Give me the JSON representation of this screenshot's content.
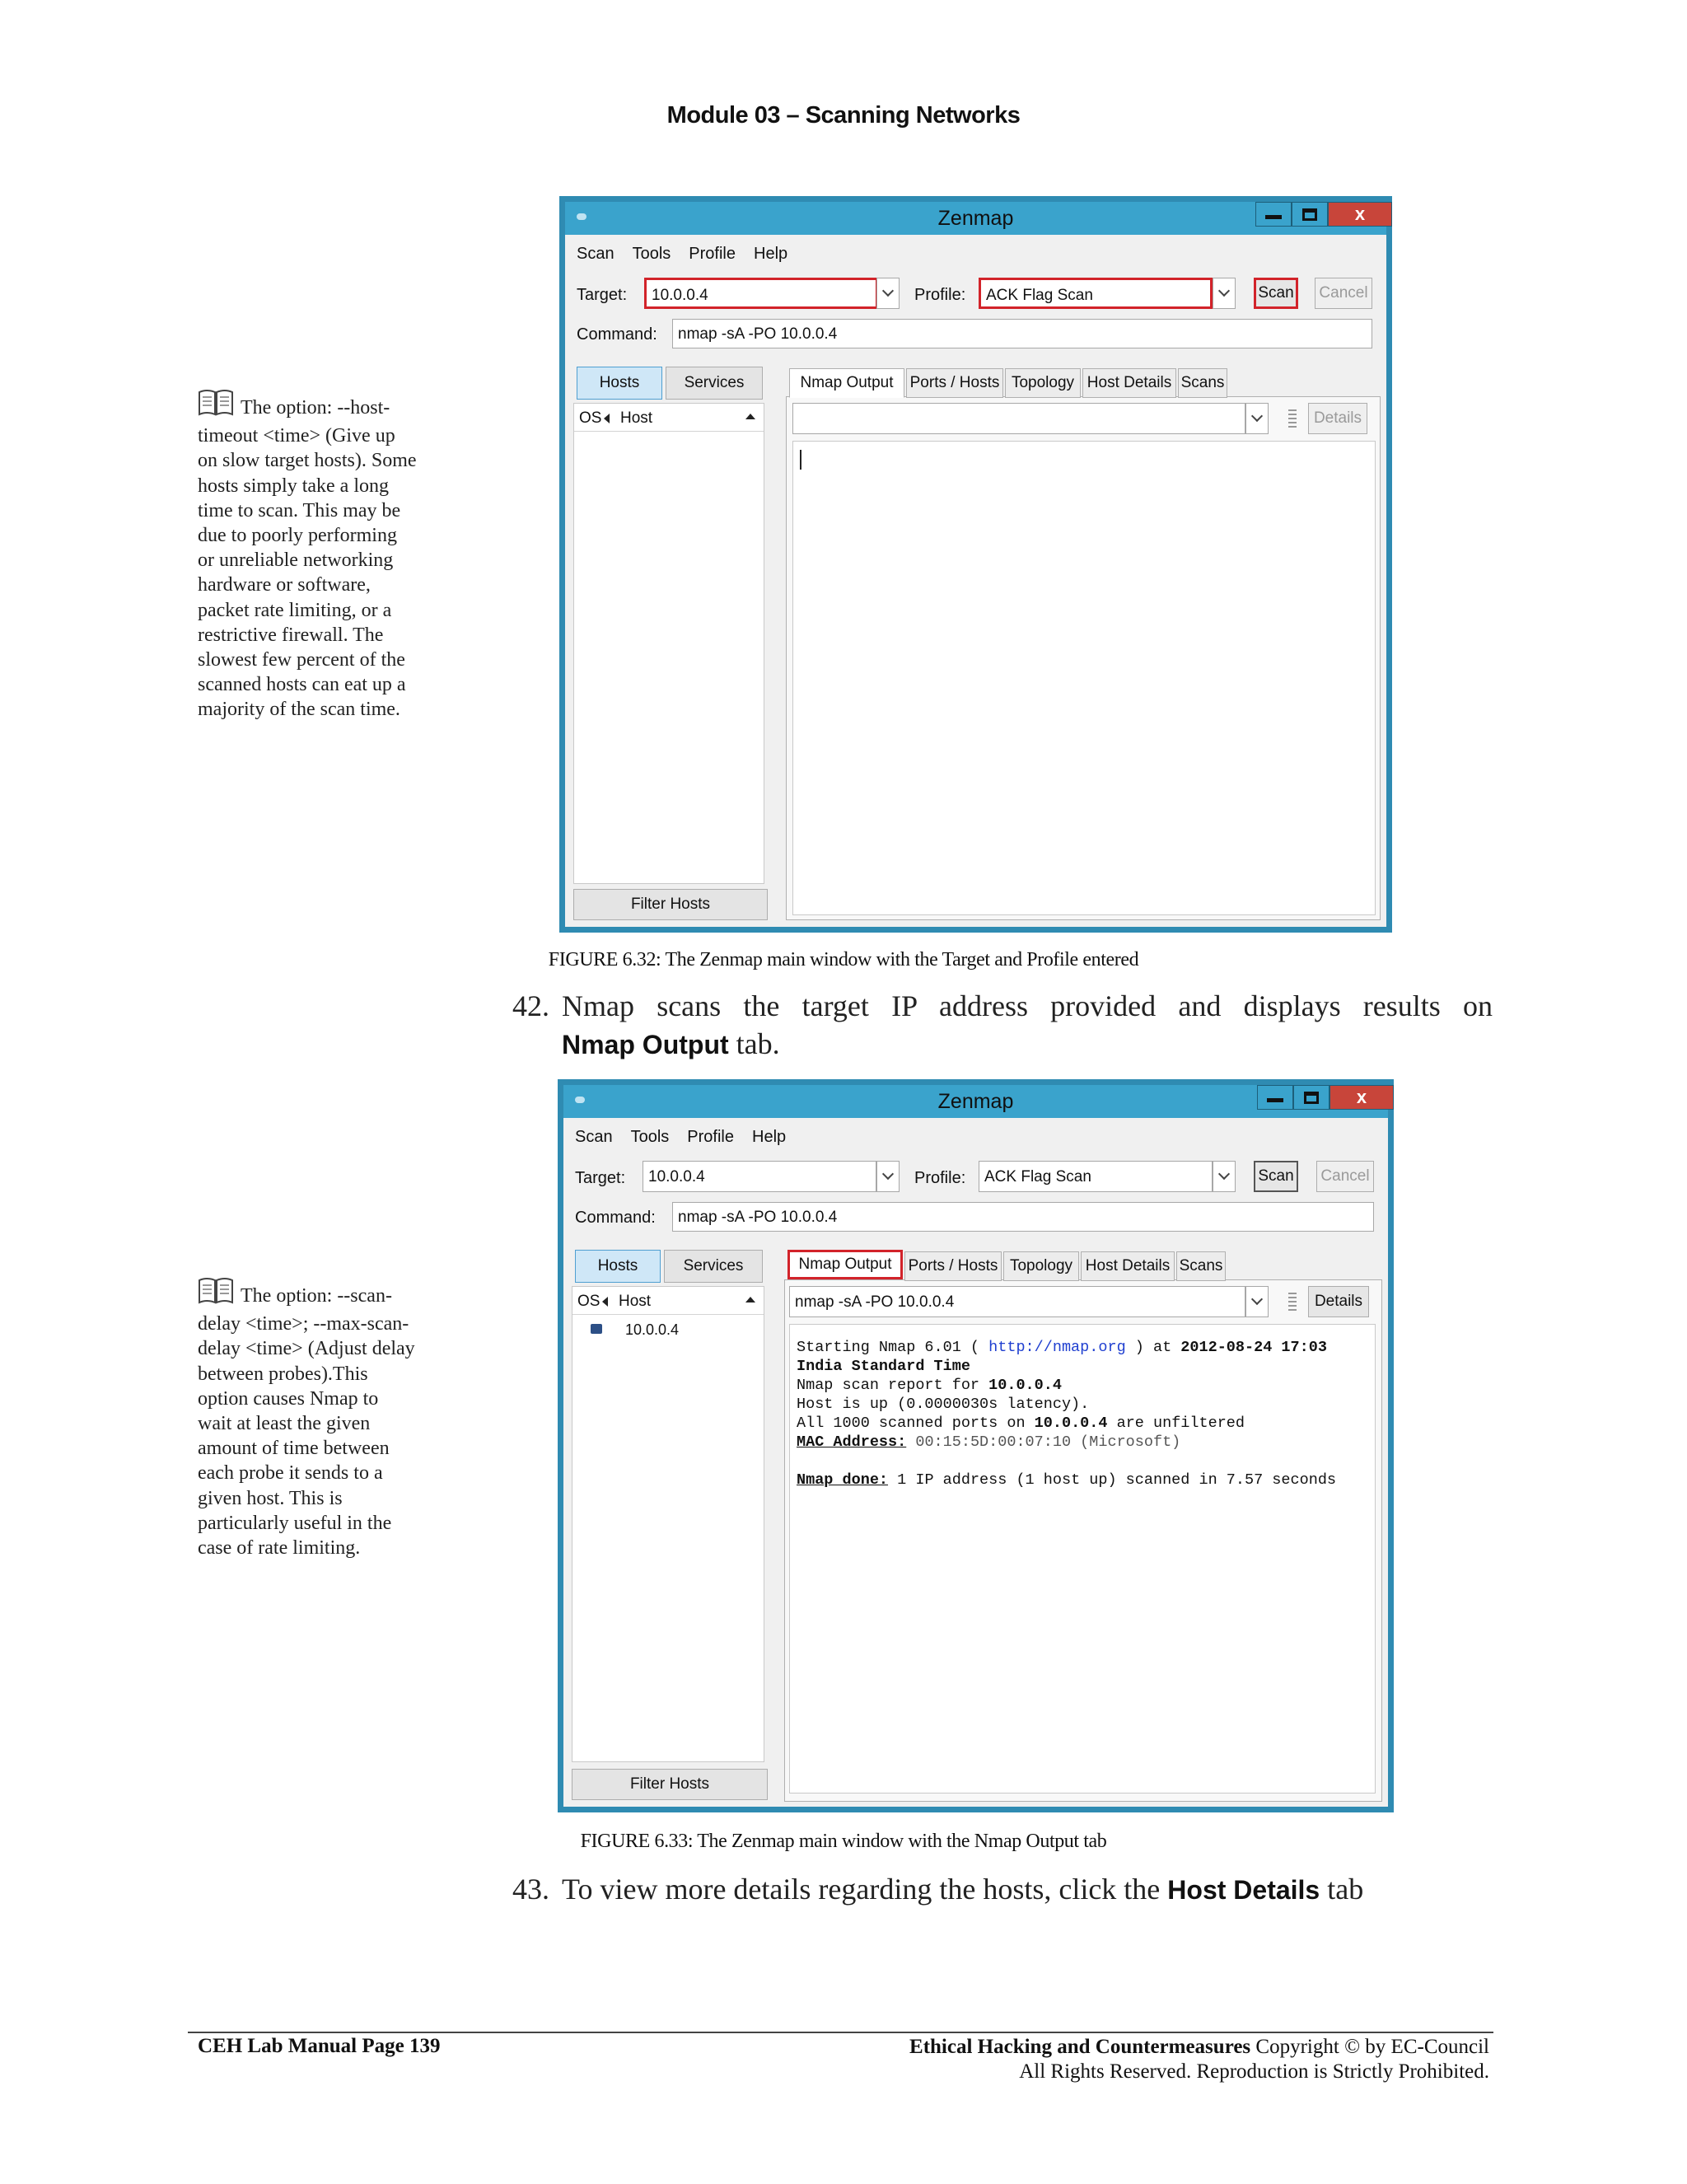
{
  "header": {
    "title": "Module 03 – Scanning Networks"
  },
  "notes": [
    {
      "lines": [
        "The option: --host-",
        "timeout <time> (Give up",
        "on slow target hosts). Some",
        "hosts simply take a long",
        "time to scan. This may be",
        "due to poorly performing",
        "or unreliable networking",
        "hardware or software,",
        "packet rate limiting, or a",
        "restrictive firewall. The",
        "slowest few percent of the",
        "scanned hosts can eat up a",
        "majority of the scan time."
      ]
    },
    {
      "lines": [
        "The option: --scan-",
        "delay <time>; --max-scan-",
        "delay <time> (Adjust delay",
        "between probes).This",
        "option causes Nmap to",
        "wait at least the given",
        "amount of time between",
        "each probe it sends to a",
        "given host. This is",
        "particularly useful in the",
        "case of rate limiting."
      ]
    }
  ],
  "window1": {
    "title": "Zenmap",
    "close_glyph": "x",
    "menu": [
      "Scan",
      "Tools",
      "Profile",
      "Help"
    ],
    "target_label": "Target:",
    "target_value": "10.0.0.4",
    "profile_label": "Profile:",
    "profile_value": "ACK Flag Scan",
    "scan_label": "Scan",
    "cancel_label": "Cancel",
    "command_label": "Command:",
    "command_value": "nmap -sA -PO 10.0.0.4",
    "hosts_tab": "Hosts",
    "services_tab": "Services",
    "os_col": "OS",
    "host_col": "Host",
    "hosts": [],
    "filter_label": "Filter Hosts",
    "tabs": [
      "Nmap Output",
      "Ports / Hosts",
      "Topology",
      "Host Details",
      "Scans"
    ],
    "output_select": "",
    "details_label": "Details",
    "output_lines": []
  },
  "caption1": "FIGURE 6.32: The Zenmap main window with the Target and Profile entered",
  "step42": {
    "number": "42.",
    "text_a": "Nmap scans the target IP address provided and displays results on",
    "bold": "Nmap Output",
    "text_b": " tab."
  },
  "window2": {
    "title": "Zenmap",
    "close_glyph": "x",
    "menu": [
      "Scan",
      "Tools",
      "Profile",
      "Help"
    ],
    "target_label": "Target:",
    "target_value": "10.0.0.4",
    "profile_label": "Profile:",
    "profile_value": "ACK Flag Scan",
    "scan_label": "Scan",
    "cancel_label": "Cancel",
    "command_label": "Command:",
    "command_value": "nmap -sA -PO 10.0.0.4",
    "hosts_tab": "Hosts",
    "services_tab": "Services",
    "os_col": "OS",
    "host_col": "Host",
    "hosts": [
      "10.0.0.4"
    ],
    "filter_label": "Filter Hosts",
    "tabs": [
      "Nmap Output",
      "Ports / Hosts",
      "Topology",
      "Host Details",
      "Scans"
    ],
    "output_select": "nmap -sA -PO 10.0.0.4",
    "details_label": "Details",
    "output": {
      "l1_a": "Starting Nmap 6.01 ( ",
      "l1_link": "http://nmap.org",
      "l1_b": " ) at ",
      "l1_date": "2012-08-24 17:03",
      "l2": "India Standard Time",
      "l3_a": "Nmap scan report for ",
      "l3_ip": "10.0.0.4",
      "l4": "Host is up (0.0000030s latency).",
      "l5_a": "All 1000 scanned ports on ",
      "l5_ip": "10.0.0.4",
      "l5_b": " are unfiltered",
      "l6_label": "MAC Address:",
      "l6_val": " 00:15:5D:00:07:10 (Microsoft)",
      "l7_label": "Nmap done:",
      "l7_val": " 1 IP address (1 host up) scanned in 7.57 seconds"
    }
  },
  "caption2": "FIGURE 6.33: The Zenmap main window with the Nmap Output tab",
  "step43": {
    "number": "43.",
    "text_a": "To view more details regarding the hosts, click the ",
    "bold": "Host Details",
    "text_b": " tab"
  },
  "footer": {
    "left": "CEH Lab Manual Page 139",
    "right_bold": "Ethical Hacking and Countermeasures",
    "right_rest": " Copyright © by EC-Council",
    "right_line2": "All Rights Reserved. Reproduction is Strictly Prohibited."
  }
}
